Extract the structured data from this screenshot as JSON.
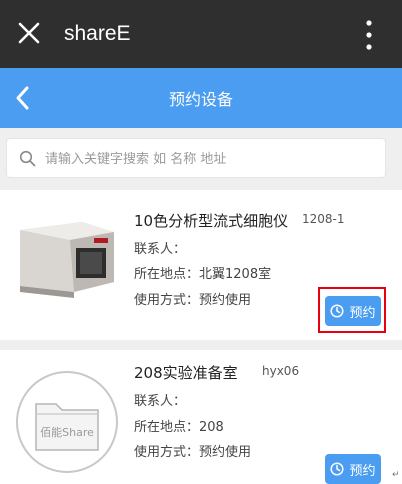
{
  "app": {
    "title": "shareE"
  },
  "nav": {
    "title": "预约设备"
  },
  "search": {
    "placeholder": "请输入关键字搜索 如 名称 地址"
  },
  "items": [
    {
      "name": "10色分析型流式细胞仪",
      "code": "1208-1",
      "contact": "联系人：",
      "location": "所在地点：北翼1208室",
      "usage": "使用方式：预约使用",
      "button": "预约",
      "highlighted": true
    },
    {
      "name": "208实验准备室",
      "code": "hyx06",
      "contact": "联系人：",
      "location": "所在地点：208",
      "usage": "使用方式：预约使用",
      "button": "预约",
      "placeholder_label": "佰能Share"
    }
  ],
  "colors": {
    "accent": "#4a9df0",
    "topbar": "#2f2f2f",
    "highlight": "#e60012"
  },
  "icons": [
    "close-icon",
    "more-vertical-icon",
    "chevron-left-icon",
    "search-icon",
    "clock-icon",
    "folder-icon"
  ],
  "footer_mark": "↵"
}
